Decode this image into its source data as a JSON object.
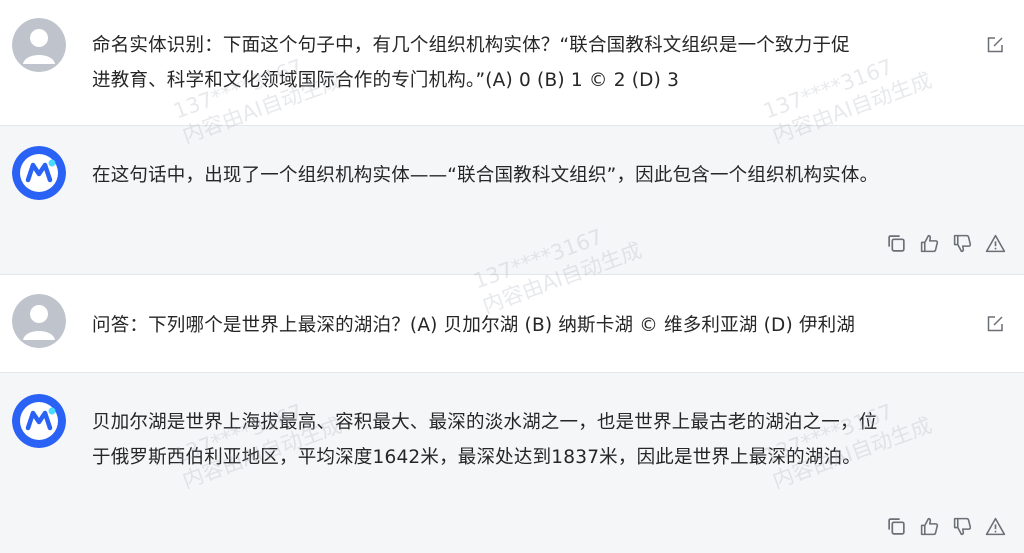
{
  "conversation": [
    {
      "role": "user",
      "avatar_icon": "user-avatar-icon",
      "lines": [
        "命名实体识别：下面这个句子中，有几个组织机构实体？“联合国教科文组织是一个致力于促",
        "进教育、科学和文化领域国际合作的专门机构。”(A) 0 (B) 1 © 2 (D) 3"
      ],
      "action_icon": "edit-icon"
    },
    {
      "role": "assistant",
      "avatar_icon": "assistant-logo-icon",
      "lines": [
        "在这句话中，出现了一个组织机构实体——“联合国教科文组织”，因此包含一个组织机构实体。"
      ],
      "action_icons": [
        "copy-icon",
        "thumbs-up-icon",
        "thumbs-down-icon",
        "report-icon"
      ]
    },
    {
      "role": "user",
      "avatar_icon": "user-avatar-icon",
      "lines": [
        "问答：下列哪个是世界上最深的湖泊？(A) 贝加尔湖 (B) 纳斯卡湖 © 维多利亚湖 (D) 伊利湖"
      ],
      "action_icon": "edit-icon"
    },
    {
      "role": "assistant",
      "avatar_icon": "assistant-logo-icon",
      "lines": [
        "贝加尔湖是世界上海拔最高、容积最大、最深的淡水湖之一，也是世界上最古老的湖泊之一，位",
        "于俄罗斯西伯利亚地区，平均深度1642米，最深处达到1837米，因此是世界上最深的湖泊。"
      ],
      "action_icons": [
        "copy-icon",
        "thumbs-up-icon",
        "thumbs-down-icon",
        "report-icon"
      ]
    }
  ],
  "watermark": {
    "id_text": "137****3167",
    "label": "内容由AI自动生成"
  },
  "colors": {
    "assistant_bg": "#f5f6f8",
    "user_bg": "#ffffff",
    "avatar_gray": "#bfc3cc",
    "brand_blue": "#2a62f5",
    "icon_gray": "#6b6f76"
  }
}
